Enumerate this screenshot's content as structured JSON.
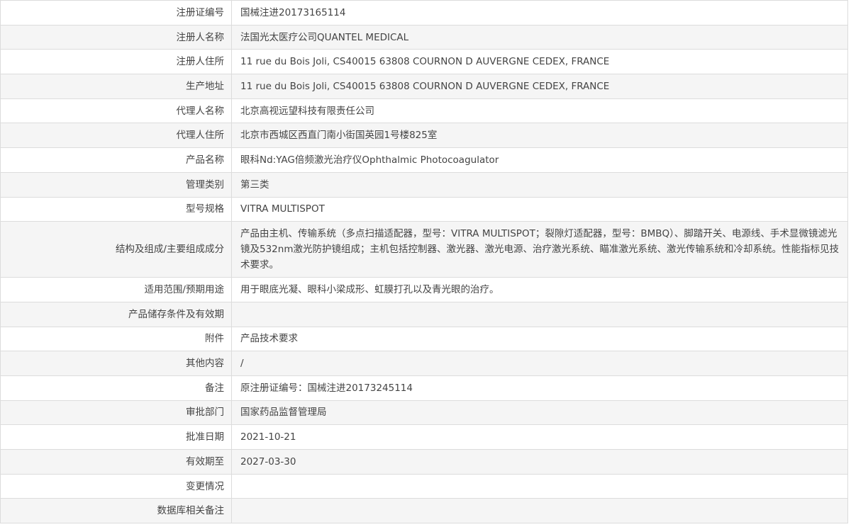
{
  "rows": [
    {
      "label": "注册证编号",
      "value": "国械注进20173165114"
    },
    {
      "label": "注册人名称",
      "value": "法国光太医疗公司QUANTEL MEDICAL"
    },
    {
      "label": "注册人住所",
      "value": "11 rue du Bois Joli, CS40015 63808 COURNON D AUVERGNE CEDEX, FRANCE"
    },
    {
      "label": "生产地址",
      "value": "11 rue du Bois Joli, CS40015 63808 COURNON D AUVERGNE CEDEX, FRANCE"
    },
    {
      "label": "代理人名称",
      "value": "北京高视远望科技有限责任公司"
    },
    {
      "label": "代理人住所",
      "value": "北京市西城区西直门南小街国英园1号楼825室"
    },
    {
      "label": "产品名称",
      "value": "眼科Nd:YAG倍频激光治疗仪Ophthalmic Photocoagulator"
    },
    {
      "label": "管理类别",
      "value": "第三类"
    },
    {
      "label": "型号规格",
      "value": "VITRA MULTISPOT"
    },
    {
      "label": "结构及组成/主要组成成分",
      "value": "产品由主机、传输系统（多点扫描适配器，型号：VITRA MULTISPOT；裂隙灯适配器，型号：BMBQ）、脚踏开关、电源线、手术显微镜滤光镜及532nm激光防护镜组成；主机包括控制器、激光器、激光电源、治疗激光系统、瞄准激光系统、激光传输系统和冷却系统。性能指标见技术要求。"
    },
    {
      "label": "适用范围/预期用途",
      "value": "用于眼底光凝、眼科小梁成形、虹膜打孔以及青光眼的治疗。"
    },
    {
      "label": "产品储存条件及有效期",
      "value": ""
    },
    {
      "label": "附件",
      "value": "产品技术要求"
    },
    {
      "label": "其他内容",
      "value": "/"
    },
    {
      "label": "备注",
      "value": "原注册证编号：国械注进20173245114"
    },
    {
      "label": "审批部门",
      "value": "国家药品监督管理局"
    },
    {
      "label": "批准日期",
      "value": "2021-10-21"
    },
    {
      "label": "有效期至",
      "value": "2027-03-30"
    },
    {
      "label": "变更情况",
      "value": ""
    },
    {
      "label": "数据库相关备注",
      "value": ""
    }
  ]
}
